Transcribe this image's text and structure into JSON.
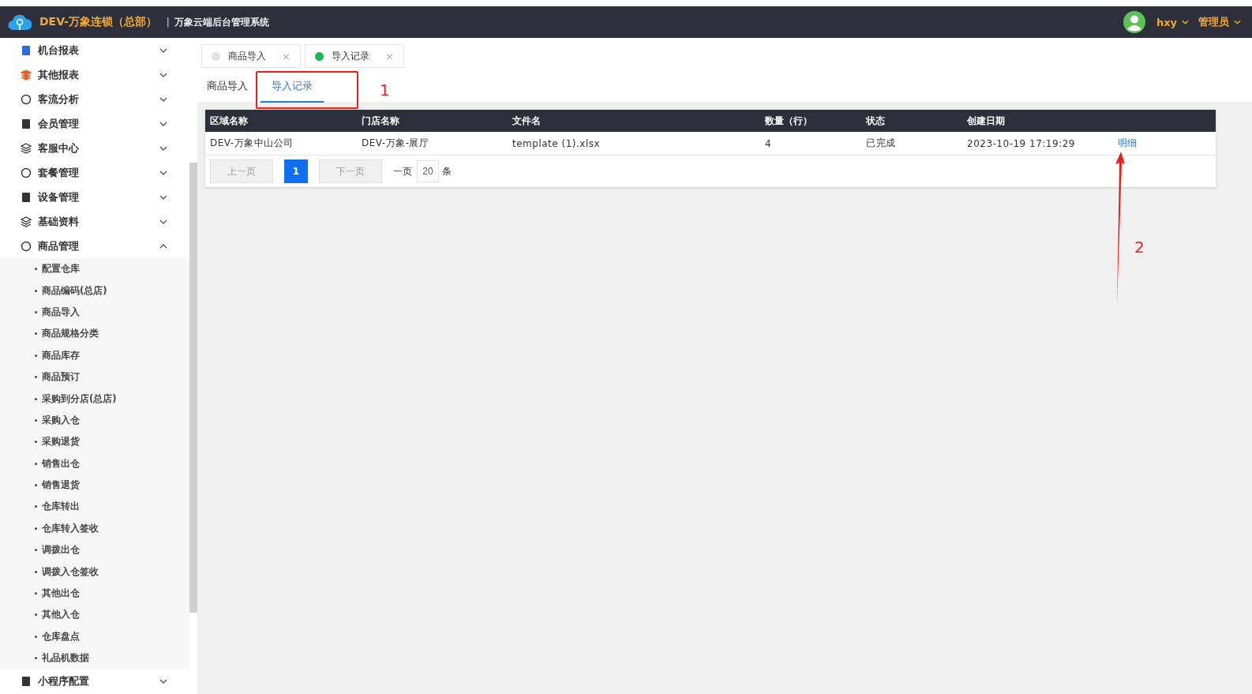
{
  "header": {
    "brand": "DEV-万象连锁（总部）",
    "separator": "|",
    "system_name": "万象云端后台管理系统",
    "user": "hxy",
    "role": "管理员"
  },
  "sidebar": {
    "items": [
      {
        "label": "机台报表",
        "expanded": false
      },
      {
        "label": "其他报表",
        "expanded": false
      },
      {
        "label": "客流分析",
        "expanded": false
      },
      {
        "label": "会员管理",
        "expanded": false
      },
      {
        "label": "客服中心",
        "expanded": false
      },
      {
        "label": "套餐管理",
        "expanded": false
      },
      {
        "label": "设备管理",
        "expanded": false
      },
      {
        "label": "基础资料",
        "expanded": false
      },
      {
        "label": "商品管理",
        "expanded": true,
        "children": [
          "配置仓库",
          "商品编码(总店)",
          "商品导入",
          "商品规格分类",
          "商品库存",
          "商品预订",
          "采购到分店(总店)",
          "采购入仓",
          "采购退货",
          "销售出仓",
          "销售退货",
          "仓库转出",
          "仓库转入签收",
          "调拨出仓",
          "调拨入仓签收",
          "其他出仓",
          "其他入仓",
          "仓库盘点",
          "礼品机数据"
        ]
      },
      {
        "label": "小程序配置",
        "expanded": false
      }
    ]
  },
  "page_tabs": [
    {
      "label": "商品导入",
      "selected": false,
      "close": "×"
    },
    {
      "label": "导入记录",
      "selected": true,
      "close": "×"
    }
  ],
  "sub_tabs": [
    {
      "label": "商品导入",
      "selected": false
    },
    {
      "label": "导入记录",
      "selected": true
    }
  ],
  "table": {
    "columns": [
      "区域名称",
      "门店名称",
      "文件名",
      "数量（行）",
      "状态",
      "创建日期"
    ],
    "rows": [
      {
        "cells": [
          "DEV-万象中山公司",
          "DEV-万象-展厅",
          "template (1).xlsx",
          "4",
          "已完成",
          "2023-10-19 17:19:29"
        ],
        "action": "明细"
      }
    ]
  },
  "pagination": {
    "prev": "上一页",
    "pages": [
      {
        "label": "1",
        "selected": true
      }
    ],
    "next": "下一页",
    "per_page_prefix": "一页",
    "per_page": "20",
    "per_page_suffix": "条"
  },
  "annotations": [
    {
      "label": "1"
    },
    {
      "label": "2"
    }
  ]
}
